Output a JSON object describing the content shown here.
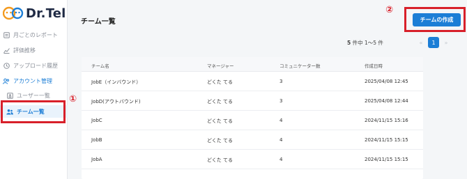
{
  "app": {
    "logo_text": "Dr.Tel"
  },
  "sidebar": {
    "items": [
      {
        "label": "月ごとのレポート",
        "icon": "report-icon"
      },
      {
        "label": "評価推移",
        "icon": "trend-chart-icon"
      },
      {
        "label": "アップロード履歴",
        "icon": "history-icon"
      },
      {
        "label": "アカウント管理",
        "icon": "people-icon"
      },
      {
        "label": "ユーザー一覧",
        "icon": "user-card-icon"
      },
      {
        "label": "チーム一覧",
        "icon": "team-icon"
      }
    ],
    "selected": "チーム一覧"
  },
  "annotations": {
    "marker1": "①",
    "marker2": "②",
    "color": "#d8202a"
  },
  "main": {
    "title": "チーム一覧",
    "create_button": "チームの作成",
    "count_bold": "5",
    "count_text": "件中 1〜5 件",
    "pager": {
      "prev": "«",
      "current": "1",
      "next": "»"
    }
  },
  "table": {
    "headers": [
      "チーム名",
      "マネージャー",
      "コミュニケーター数",
      "作成日時"
    ],
    "rows": [
      [
        "JobE（インバウンド）",
        "どくた てる",
        "3",
        "2025/04/08 12:45"
      ],
      [
        "JobD(アウトバウンド)",
        "どくた てる",
        "3",
        "2025/04/08 12:44"
      ],
      [
        "JobC",
        "どくた てる",
        "4",
        "2024/11/15 15:16"
      ],
      [
        "JobB",
        "どくた てる",
        "4",
        "2024/11/15 15:15"
      ],
      [
        "JobA",
        "どくた てる",
        "4",
        "2024/11/15 15:15"
      ]
    ]
  },
  "colors": {
    "accent": "#1c7ed6",
    "annotation": "#d8202a",
    "logo_orange": "#f39a1e"
  }
}
